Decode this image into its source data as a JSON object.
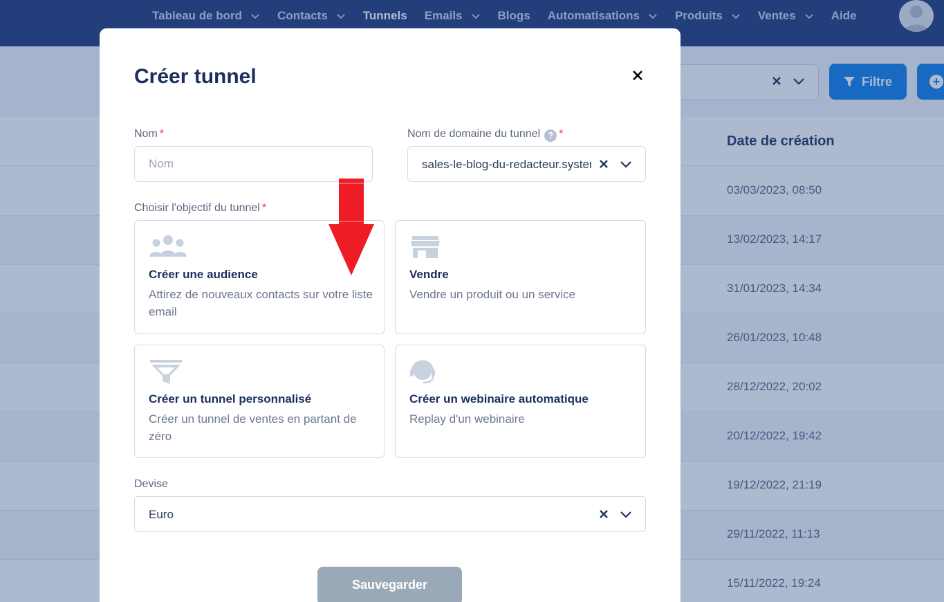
{
  "nav": {
    "items": [
      {
        "label": "Tableau de bord",
        "dropdown": true,
        "active": false
      },
      {
        "label": "Contacts",
        "dropdown": true,
        "active": false
      },
      {
        "label": "Tunnels",
        "dropdown": false,
        "active": true
      },
      {
        "label": "Emails",
        "dropdown": true,
        "active": false
      },
      {
        "label": "Blogs",
        "dropdown": false,
        "active": false
      },
      {
        "label": "Automatisations",
        "dropdown": true,
        "active": false
      },
      {
        "label": "Produits",
        "dropdown": true,
        "active": false
      },
      {
        "label": "Ventes",
        "dropdown": true,
        "active": false
      },
      {
        "label": "Aide",
        "dropdown": false,
        "active": false
      }
    ]
  },
  "toolbar": {
    "filter_label": "Filtre"
  },
  "table": {
    "date_header": "Date de création",
    "dates": [
      "03/03/2023, 08:50",
      "13/02/2023, 14:17",
      "31/01/2023, 14:34",
      "26/01/2023, 10:48",
      "28/12/2022, 20:02",
      "20/12/2022, 19:42",
      "19/12/2022, 21:19",
      "29/11/2022, 11:13",
      "15/11/2022, 19:24"
    ]
  },
  "modal": {
    "title": "Créer tunnel",
    "name_label": "Nom",
    "name_placeholder": "Nom",
    "name_value": "",
    "domain_label": "Nom de domaine du tunnel",
    "domain_value": "sales-le-blog-du-redacteur.systeme.io",
    "required_mark": "*",
    "help_mark": "?",
    "objective_label": "Choisir l'objectif du tunnel",
    "cards": [
      {
        "icon": "users-icon",
        "title": "Créer une audience",
        "description": "Attirez de nouveaux contacts sur votre liste email"
      },
      {
        "icon": "store-icon",
        "title": "Vendre",
        "description": "Vendre un produit ou un service"
      },
      {
        "icon": "funnel-icon",
        "title": "Créer un tunnel personnalisé",
        "description": "Créer un tunnel de ventes en partant de zéro"
      },
      {
        "icon": "headset-icon",
        "title": "Créer un webinaire automatique",
        "description": "Replay d'un webinaire"
      }
    ],
    "currency_label": "Devise",
    "currency_value": "Euro",
    "save_label": "Sauvegarder"
  },
  "colors": {
    "nav_bg": "#1f3a7a",
    "accent": "#0d7ee9",
    "title": "#1b2f5e",
    "required": "#e53935",
    "annotation_arrow": "#ee1c25",
    "save_disabled": "#9aa9b8"
  }
}
